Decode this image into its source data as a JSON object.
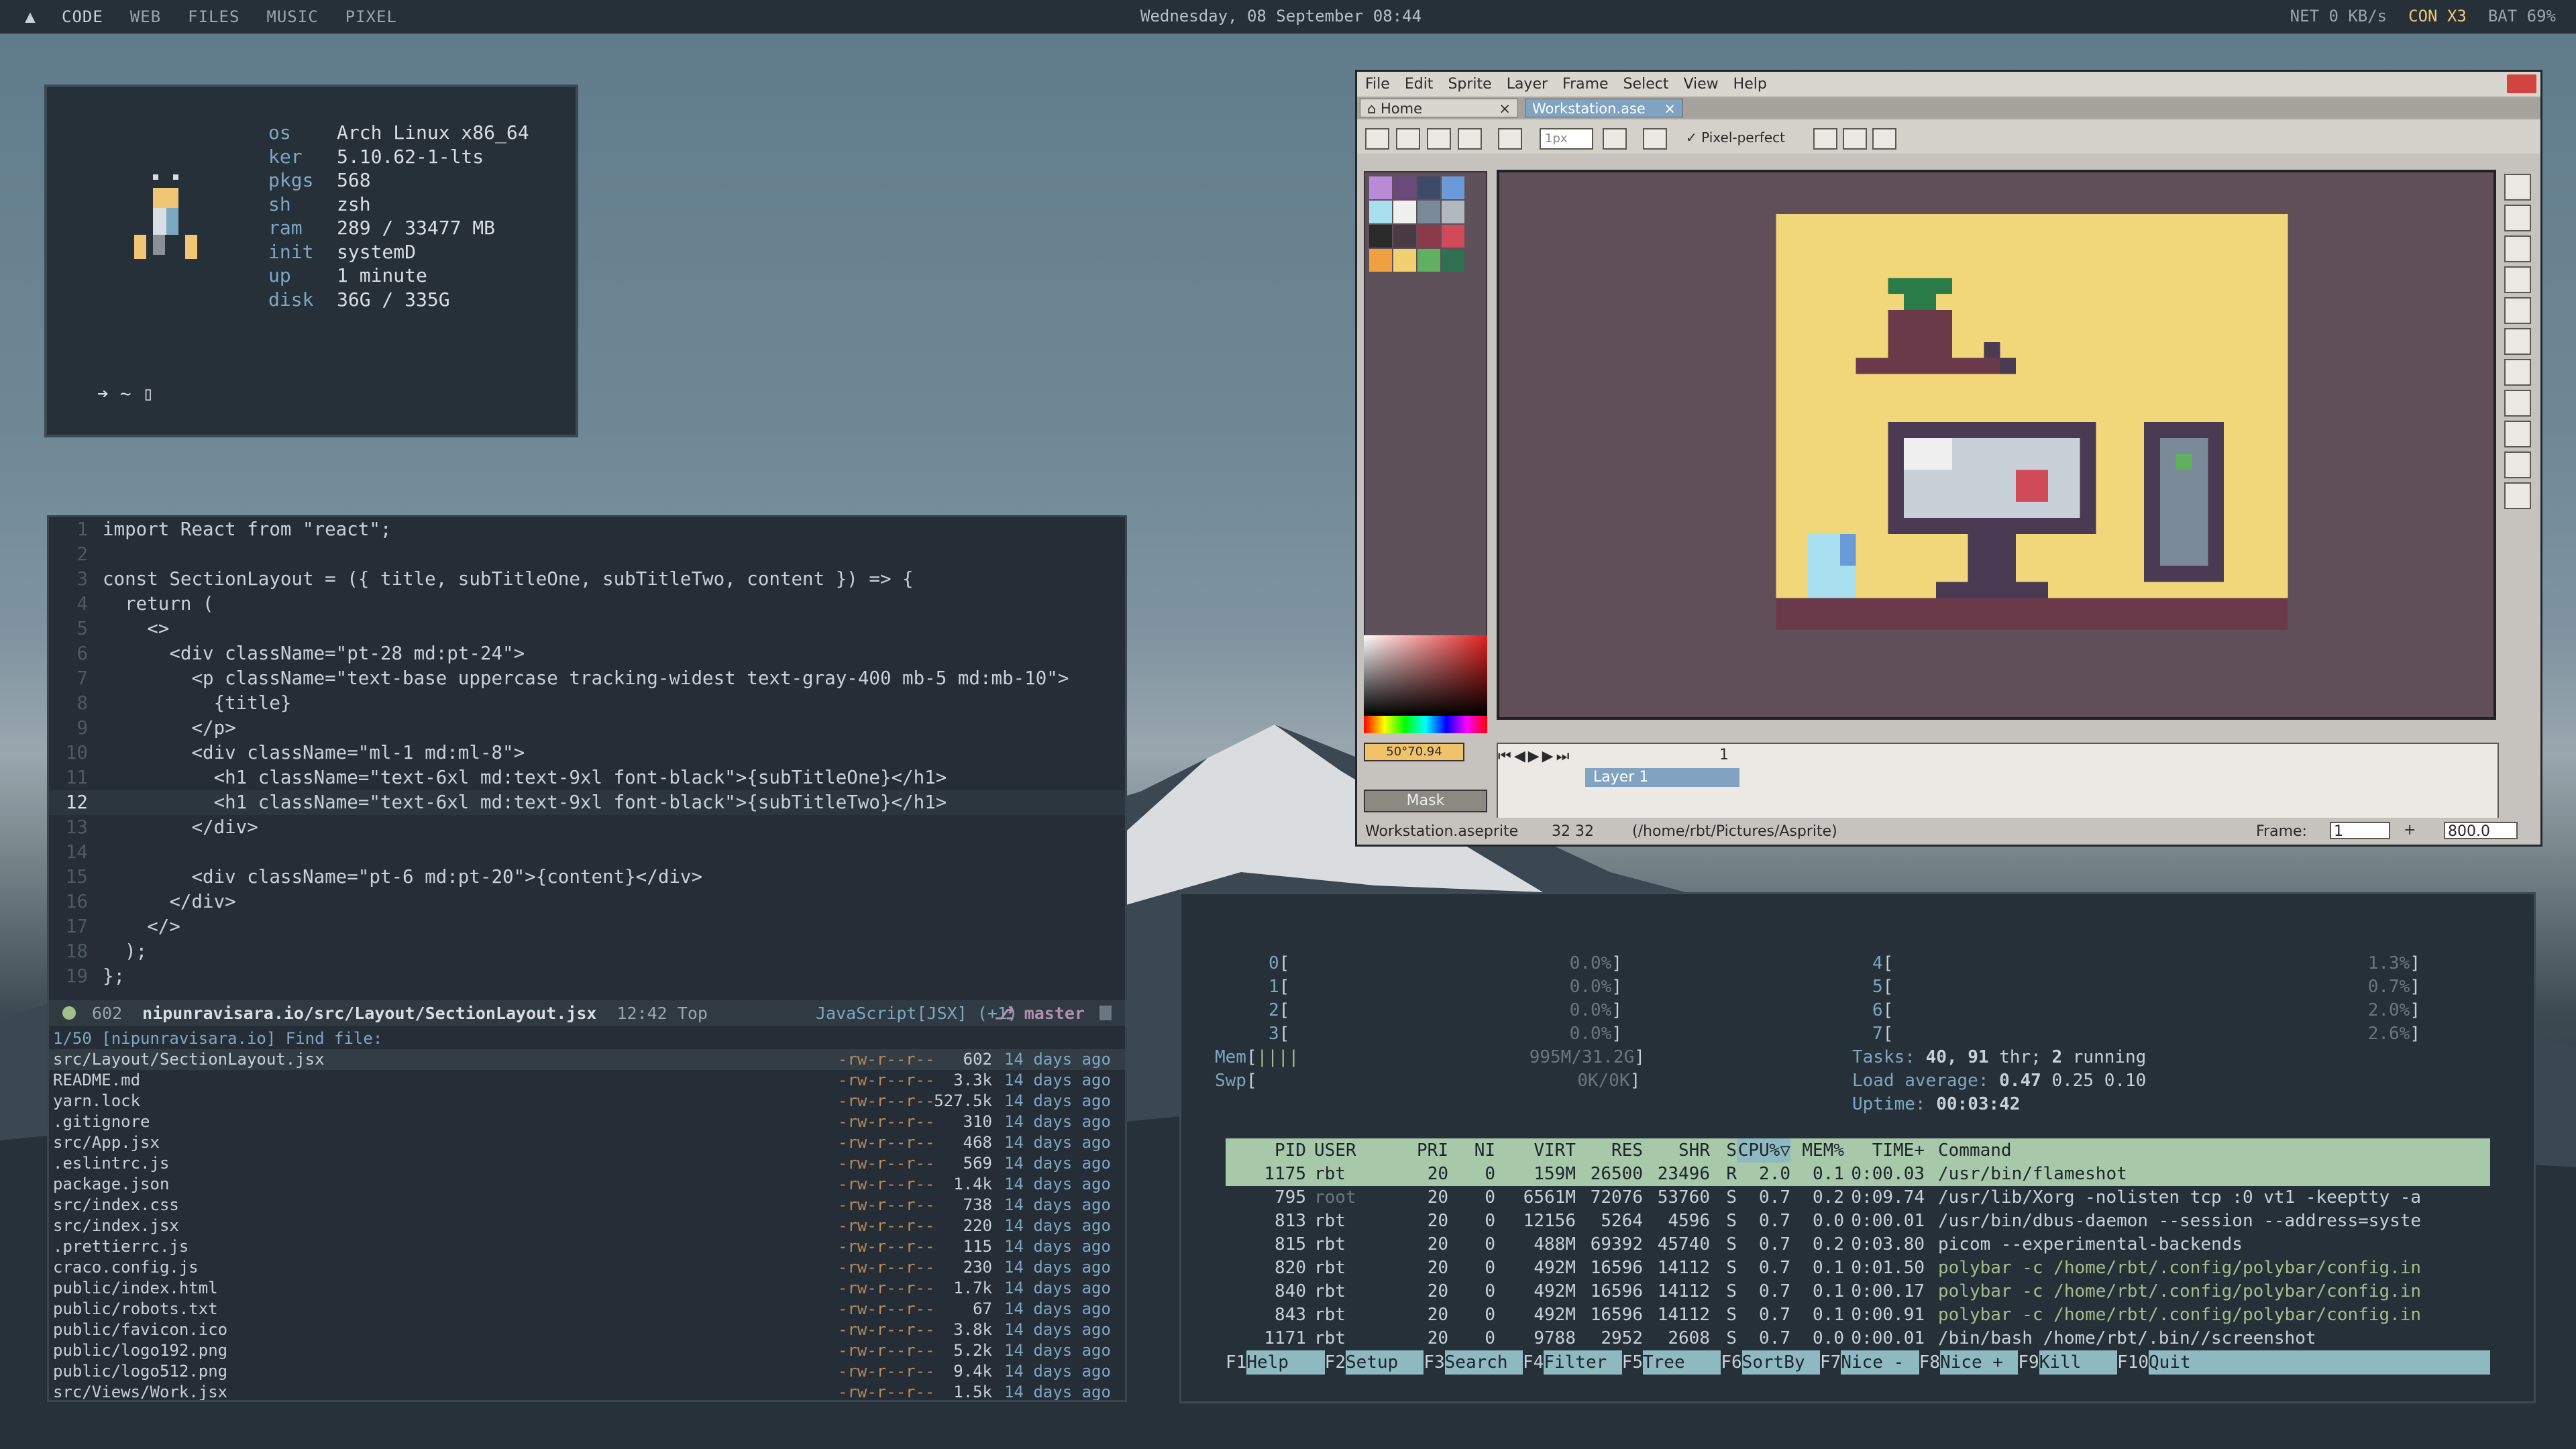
{
  "topbar": {
    "workspaces": [
      "CODE",
      "WEB",
      "FILES",
      "MUSIC",
      "PIXEL"
    ],
    "clock": "Wednesday, 08 September 08:44",
    "net": "NET 0 KB/s",
    "con": "CON X3",
    "bat": "BAT 69%"
  },
  "neofetch": {
    "rows": [
      {
        "k": "os",
        "v": "Arch Linux x86_64"
      },
      {
        "k": "ker",
        "v": "5.10.62-1-lts"
      },
      {
        "k": "pkgs",
        "v": "568"
      },
      {
        "k": "sh",
        "v": "zsh"
      },
      {
        "k": "ram",
        "v": "289 / 33477 MB"
      },
      {
        "k": "init",
        "v": "systemD"
      },
      {
        "k": "up",
        "v": "1 minute"
      },
      {
        "k": "disk",
        "v": "36G / 335G"
      }
    ],
    "prompt": "➔ ~ ▯"
  },
  "editor": {
    "lines": [
      {
        "n": "1",
        "t": "import React from \"react\";"
      },
      {
        "n": "2",
        "t": ""
      },
      {
        "n": "3",
        "t": "const SectionLayout = ({ title, subTitleOne, subTitleTwo, content }) => {"
      },
      {
        "n": "4",
        "t": "  return ("
      },
      {
        "n": "5",
        "t": "    <>"
      },
      {
        "n": "6",
        "t": "      <div className=\"pt-28 md:pt-24\">"
      },
      {
        "n": "7",
        "t": "        <p className=\"text-base uppercase tracking-widest text-gray-400 mb-5 md:mb-10\">"
      },
      {
        "n": "8",
        "t": "          {title}"
      },
      {
        "n": "9",
        "t": "        </p>"
      },
      {
        "n": "10",
        "t": "        <div className=\"ml-1 md:ml-8\">"
      },
      {
        "n": "11",
        "t": "          <h1 className=\"text-6xl md:text-9xl font-black\">{subTitleOne}</h1>"
      },
      {
        "n": "12",
        "t": "          <h1 className=\"text-6xl md:text-9xl font-black\">{subTitleTwo}</h1>"
      },
      {
        "n": "13",
        "t": "        </div>"
      },
      {
        "n": "14",
        "t": ""
      },
      {
        "n": "15",
        "t": "        <div className=\"pt-6 md:pt-20\">{content}</div>"
      },
      {
        "n": "16",
        "t": "      </div>"
      },
      {
        "n": "17",
        "t": "    </>"
      },
      {
        "n": "18",
        "t": "  );"
      },
      {
        "n": "19",
        "t": "};"
      }
    ],
    "status": {
      "size": "602",
      "path": "nipunravisara.io/src/Layout/SectionLayout.jsx",
      "pos": "12:42 Top",
      "lang": "JavaScript[JSX] (+1)",
      "branch": "master"
    },
    "finder": {
      "header": "1/50   [nipunravisara.io] Find file:",
      "files": [
        {
          "name": "src/Layout/SectionLayout.jsx",
          "perm": "-rw-r--r--",
          "size": "602",
          "age": "14 days ago"
        },
        {
          "name": "README.md",
          "perm": "-rw-r--r--",
          "size": "3.3k",
          "age": "14 days ago"
        },
        {
          "name": "yarn.lock",
          "perm": "-rw-r--r--",
          "size": "527.5k",
          "age": "14 days ago"
        },
        {
          "name": ".gitignore",
          "perm": "-rw-r--r--",
          "size": "310",
          "age": "14 days ago"
        },
        {
          "name": "src/App.jsx",
          "perm": "-rw-r--r--",
          "size": "468",
          "age": "14 days ago"
        },
        {
          "name": ".eslintrc.js",
          "perm": "-rw-r--r--",
          "size": "569",
          "age": "14 days ago"
        },
        {
          "name": "package.json",
          "perm": "-rw-r--r--",
          "size": "1.4k",
          "age": "14 days ago"
        },
        {
          "name": "src/index.css",
          "perm": "-rw-r--r--",
          "size": "738",
          "age": "14 days ago"
        },
        {
          "name": "src/index.jsx",
          "perm": "-rw-r--r--",
          "size": "220",
          "age": "14 days ago"
        },
        {
          "name": ".prettierrc.js",
          "perm": "-rw-r--r--",
          "size": "115",
          "age": "14 days ago"
        },
        {
          "name": "craco.config.js",
          "perm": "-rw-r--r--",
          "size": "230",
          "age": "14 days ago"
        },
        {
          "name": "public/index.html",
          "perm": "-rw-r--r--",
          "size": "1.7k",
          "age": "14 days ago"
        },
        {
          "name": "public/robots.txt",
          "perm": "-rw-r--r--",
          "size": "67",
          "age": "14 days ago"
        },
        {
          "name": "public/favicon.ico",
          "perm": "-rw-r--r--",
          "size": "3.8k",
          "age": "14 days ago"
        },
        {
          "name": "public/logo192.png",
          "perm": "-rw-r--r--",
          "size": "5.2k",
          "age": "14 days ago"
        },
        {
          "name": "public/logo512.png",
          "perm": "-rw-r--r--",
          "size": "9.4k",
          "age": "14 days ago"
        },
        {
          "name": "src/Views/Work.jsx",
          "perm": "-rw-r--r--",
          "size": "1.5k",
          "age": "14 days ago"
        }
      ]
    }
  },
  "aseprite": {
    "menu": [
      "File",
      "Edit",
      "Sprite",
      "Layer",
      "Frame",
      "Select",
      "View",
      "Help"
    ],
    "tabs": [
      {
        "label": "Home"
      },
      {
        "label": "Workstation.ase"
      }
    ],
    "toolbar": {
      "brush_size": "1px",
      "pixel_perfect": "Pixel-perfect"
    },
    "color_value": "50°70.94",
    "mask_label": "Mask",
    "layer": "Layer 1",
    "frame_col": "1",
    "status": {
      "file": "Workstation.aseprite",
      "dims": "32 32",
      "path": "(/home/rbt/Pictures/Asprite)",
      "frame_label": "Frame:",
      "frame_val": "1",
      "zoom": "800.0"
    }
  },
  "htop": {
    "cpus": [
      {
        "id": "0",
        "pct": "0.0%"
      },
      {
        "id": "1",
        "pct": "0.0%"
      },
      {
        "id": "2",
        "pct": "0.0%"
      },
      {
        "id": "3",
        "pct": "0.0%"
      },
      {
        "id": "4",
        "pct": "1.3%"
      },
      {
        "id": "5",
        "pct": "0.7%"
      },
      {
        "id": "6",
        "pct": "2.0%"
      },
      {
        "id": "7",
        "pct": "2.6%"
      }
    ],
    "mem": "995M/31.2G",
    "swp": "0K/0K",
    "tasks_label": "Tasks:",
    "tasks": "40,",
    "thr": "91",
    "thr_label": "thr;",
    "running": "2",
    "running_label": "running",
    "load_label": "Load average:",
    "load1": "0.47",
    "load5": "0.25",
    "load15": "0.10",
    "uptime_label": "Uptime:",
    "uptime": "00:03:42",
    "headers": {
      "pid": "PID",
      "user": "USER",
      "pri": "PRI",
      "ni": "NI",
      "virt": "VIRT",
      "res": "RES",
      "shr": "SHR",
      "s": "S",
      "cpu": "CPU%▽",
      "mem": "MEM%",
      "time": "TIME+",
      "cmd": "Command"
    },
    "procs": [
      {
        "pid": "1175",
        "user": "rbt",
        "pri": "20",
        "ni": "0",
        "virt": "159M",
        "res": "26500",
        "shr": "23496",
        "s": "R",
        "cpu": "2.0",
        "mem": "0.1",
        "time": "0:00.03",
        "cmd": "/usr/bin/flameshot"
      },
      {
        "pid": "795",
        "user": "root",
        "pri": "20",
        "ni": "0",
        "virt": "6561M",
        "res": "72076",
        "shr": "53760",
        "s": "S",
        "cpu": "0.7",
        "mem": "0.2",
        "time": "0:09.74",
        "cmd": "/usr/lib/Xorg -nolisten tcp :0 vt1 -keeptty -a"
      },
      {
        "pid": "813",
        "user": "rbt",
        "pri": "20",
        "ni": "0",
        "virt": "12156",
        "res": "5264",
        "shr": "4596",
        "s": "S",
        "cpu": "0.7",
        "mem": "0.0",
        "time": "0:00.01",
        "cmd": "/usr/bin/dbus-daemon --session --address=syste"
      },
      {
        "pid": "815",
        "user": "rbt",
        "pri": "20",
        "ni": "0",
        "virt": "488M",
        "res": "69392",
        "shr": "45740",
        "s": "S",
        "cpu": "0.7",
        "mem": "0.2",
        "time": "0:03.80",
        "cmd": "picom --experimental-backends"
      },
      {
        "pid": "820",
        "user": "rbt",
        "pri": "20",
        "ni": "0",
        "virt": "492M",
        "res": "16596",
        "shr": "14112",
        "s": "S",
        "cpu": "0.7",
        "mem": "0.1",
        "time": "0:01.50",
        "cmd": "polybar -c /home/rbt/.config/polybar/config.in"
      },
      {
        "pid": "840",
        "user": "rbt",
        "pri": "20",
        "ni": "0",
        "virt": "492M",
        "res": "16596",
        "shr": "14112",
        "s": "S",
        "cpu": "0.7",
        "mem": "0.1",
        "time": "0:00.17",
        "cmd": "polybar -c /home/rbt/.config/polybar/config.in"
      },
      {
        "pid": "843",
        "user": "rbt",
        "pri": "20",
        "ni": "0",
        "virt": "492M",
        "res": "16596",
        "shr": "14112",
        "s": "S",
        "cpu": "0.7",
        "mem": "0.1",
        "time": "0:00.91",
        "cmd": "polybar -c /home/rbt/.config/polybar/config.in"
      },
      {
        "pid": "1171",
        "user": "rbt",
        "pri": "20",
        "ni": "0",
        "virt": "9788",
        "res": "2952",
        "shr": "2608",
        "s": "S",
        "cpu": "0.7",
        "mem": "0.0",
        "time": "0:00.01",
        "cmd": "/bin/bash /home/rbt/.bin//screenshot"
      }
    ],
    "fkeys": [
      {
        "k": "F1",
        "l": "Help  "
      },
      {
        "k": "F2",
        "l": "Setup "
      },
      {
        "k": "F3",
        "l": "Search"
      },
      {
        "k": "F4",
        "l": "Filter"
      },
      {
        "k": "F5",
        "l": "Tree  "
      },
      {
        "k": "F6",
        "l": "SortBy"
      },
      {
        "k": "F7",
        "l": "Nice -"
      },
      {
        "k": "F8",
        "l": "Nice +"
      },
      {
        "k": "F9",
        "l": "Kill  "
      },
      {
        "k": "F10",
        "l": "Quit"
      }
    ]
  }
}
